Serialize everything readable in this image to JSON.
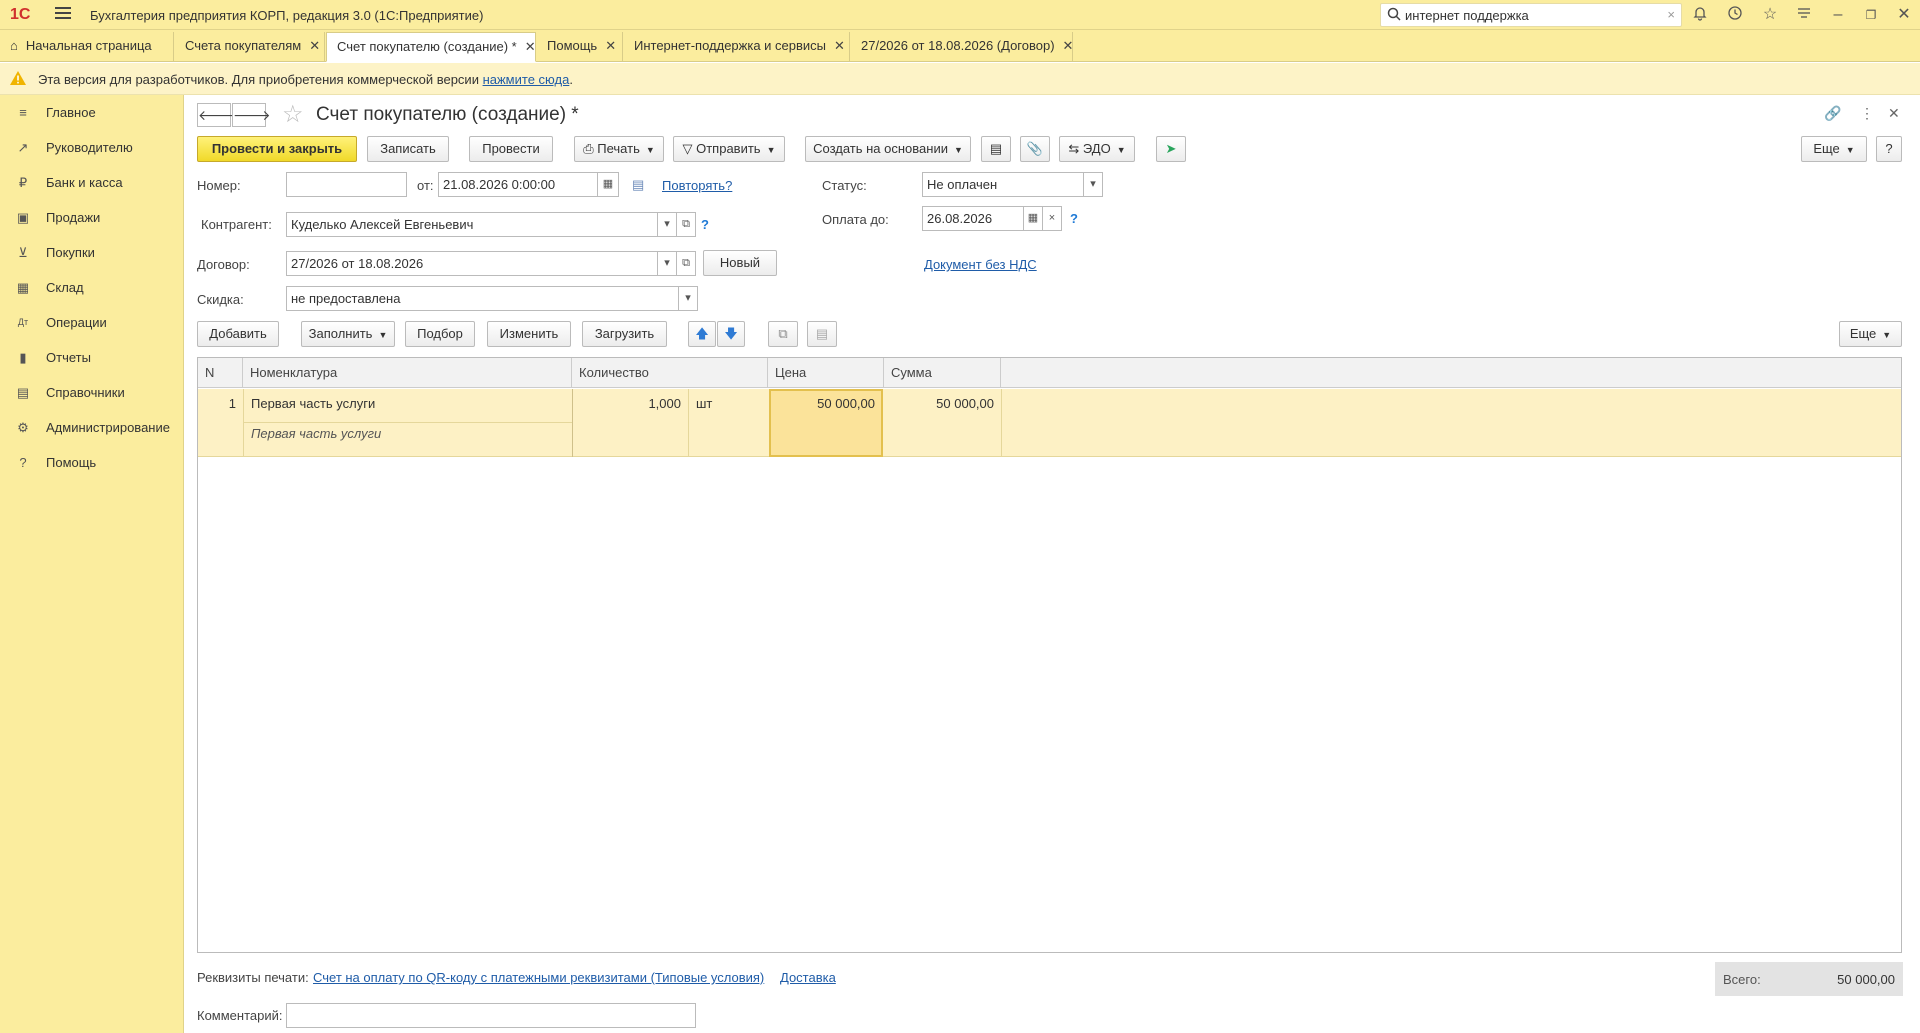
{
  "titlebar": {
    "logo": "1С",
    "app_title": "Бухгалтерия предприятия КОРП, редакция 3.0  (1С:Предприятие)",
    "search_value": "интернет поддержка"
  },
  "tabs": [
    {
      "label": "Начальная страница"
    },
    {
      "label": "Счета покупателям"
    },
    {
      "label": "Счет покупателю (создание) *"
    },
    {
      "label": "Помощь"
    },
    {
      "label": "Интернет-поддержка и сервисы"
    },
    {
      "label": "27/2026 от 18.08.2026 (Договор)"
    }
  ],
  "warning": {
    "text": "Эта версия для разработчиков. Для приобретения коммерческой версии ",
    "link": "нажмите сюда",
    "suffix": "."
  },
  "sidebar": {
    "items": [
      {
        "label": "Главное",
        "icon": "menu-icon"
      },
      {
        "label": "Руководителю",
        "icon": "trend-icon"
      },
      {
        "label": "Банк и касса",
        "icon": "ruble-icon"
      },
      {
        "label": "Продажи",
        "icon": "bag-icon"
      },
      {
        "label": "Покупки",
        "icon": "cart-icon"
      },
      {
        "label": "Склад",
        "icon": "grid-icon"
      },
      {
        "label": "Операции",
        "icon": "dt-kt-icon"
      },
      {
        "label": "Отчеты",
        "icon": "bar-chart-icon"
      },
      {
        "label": "Справочники",
        "icon": "books-icon"
      },
      {
        "label": "Администрирование",
        "icon": "gear-icon"
      },
      {
        "label": "Помощь",
        "icon": "question-icon"
      }
    ]
  },
  "doc": {
    "title": "Счет покупателю (создание) *",
    "toolbar": {
      "post_close": "Провести и закрыть",
      "save": "Записать",
      "post": "Провести",
      "print": "Печать",
      "send": "Отправить",
      "create_based": "Создать на основании",
      "edo": "ЭДО",
      "more": "Еще",
      "help": "?"
    },
    "form": {
      "number_label": "Номер:",
      "number_value": "",
      "from_label": "от:",
      "date_value": "21.08.2026  0:00:00",
      "repeat_link": "Повторять?",
      "status_label": "Статус:",
      "status_value": "Не оплачен",
      "counterparty_label": "Контрагент:",
      "counterparty_value": "Куделько Алексей Евгеньевич",
      "pay_until_label": "Оплата до:",
      "pay_until_value": "26.08.2026",
      "contract_label": "Договор:",
      "contract_value": "27/2026 от 18.08.2026",
      "new_button": "Новый",
      "vat_link": "Документ без НДС",
      "discount_label": "Скидка:",
      "discount_value": "не предоставлена",
      "q": "?"
    },
    "table_toolbar": {
      "add": "Добавить",
      "fill": "Заполнить",
      "pick": "Подбор",
      "change": "Изменить",
      "load": "Загрузить",
      "more": "Еще"
    },
    "table": {
      "headers": [
        "N",
        "Номенклатура",
        "Количество",
        "Цена",
        "Сумма"
      ],
      "rows": [
        {
          "n": "1",
          "item": "Первая часть услуги",
          "item_desc": "Первая часть услуги",
          "qty": "1,000",
          "unit": "шт",
          "price": "50 000,00",
          "sum": "50 000,00"
        }
      ]
    },
    "footer": {
      "print_props_label": "Реквизиты печати:",
      "print_props_link": "Счет на оплату по QR-коду с платежными реквизитами (Типовые условия)",
      "delivery_link": "Доставка",
      "total_label": "Всего:",
      "total_value": "50 000,00",
      "comment_label": "Комментарий:",
      "comment_value": ""
    }
  }
}
